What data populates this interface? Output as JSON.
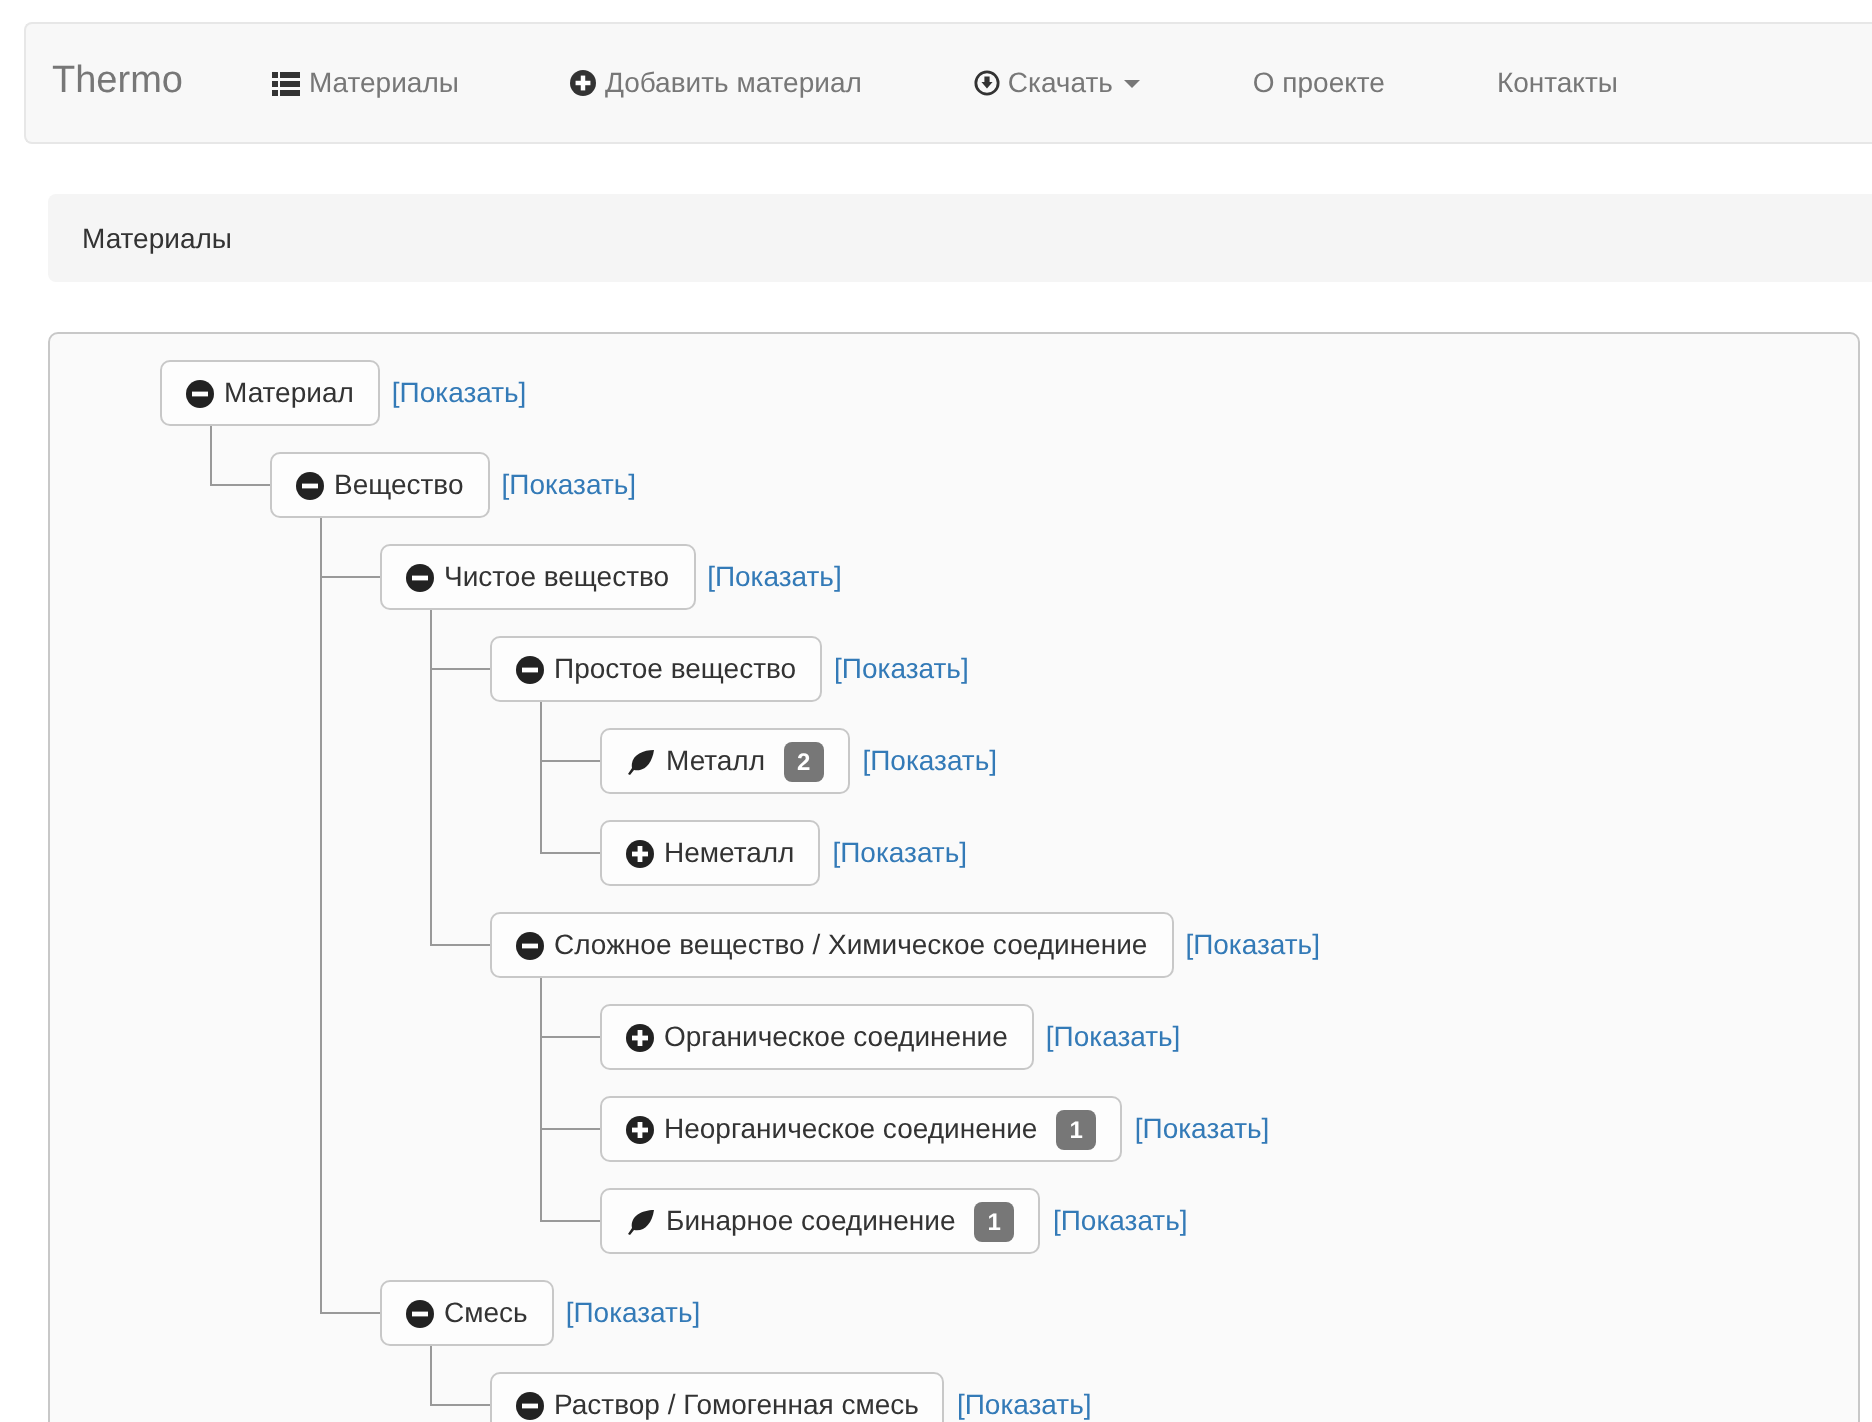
{
  "navbar": {
    "brand": "Thermo",
    "items": [
      {
        "label": "Материалы",
        "kind": "list",
        "dropdown": false
      },
      {
        "label": "Добавить материал",
        "kind": "add",
        "dropdown": false
      },
      {
        "label": "Скачать",
        "kind": "download",
        "dropdown": true
      },
      {
        "label": "О проекте",
        "kind": "plain",
        "dropdown": false
      },
      {
        "label": "Контакты",
        "kind": "plain",
        "dropdown": false
      }
    ]
  },
  "breadcrumb": "Материалы",
  "tree": [
    {
      "label": "Материал",
      "kind": "expanded",
      "link": "[Показать]",
      "children": [
        {
          "label": "Вещество",
          "kind": "expanded",
          "link": "[Показать]",
          "children": [
            {
              "label": "Чистое вещество",
              "kind": "expanded",
              "link": "[Показать]",
              "children": [
                {
                  "label": "Простое вещество",
                  "kind": "expanded",
                  "link": "[Показать]",
                  "children": [
                    {
                      "label": "Металл",
                      "kind": "leaf",
                      "badge": "2",
                      "link": "[Показать]"
                    },
                    {
                      "label": "Неметалл",
                      "kind": "collapsed",
                      "link": "[Показать]"
                    }
                  ]
                },
                {
                  "label": "Сложное вещество / Химическое соединение",
                  "kind": "expanded",
                  "link": "[Показать]",
                  "children": [
                    {
                      "label": "Органическое соединение",
                      "kind": "collapsed",
                      "link": "[Показать]"
                    },
                    {
                      "label": "Неорганическое соединение",
                      "kind": "collapsed",
                      "badge": "1",
                      "link": "[Показать]"
                    },
                    {
                      "label": "Бинарное соединение",
                      "kind": "leaf",
                      "badge": "1",
                      "link": "[Показать]"
                    }
                  ]
                }
              ]
            },
            {
              "label": "Смесь",
              "kind": "expanded",
              "link": "[Показать]",
              "children": [
                {
                  "label": "Раствор / Гомогенная смесь",
                  "kind": "expanded",
                  "link": "[Показать]"
                }
              ]
            }
          ]
        }
      ]
    }
  ]
}
